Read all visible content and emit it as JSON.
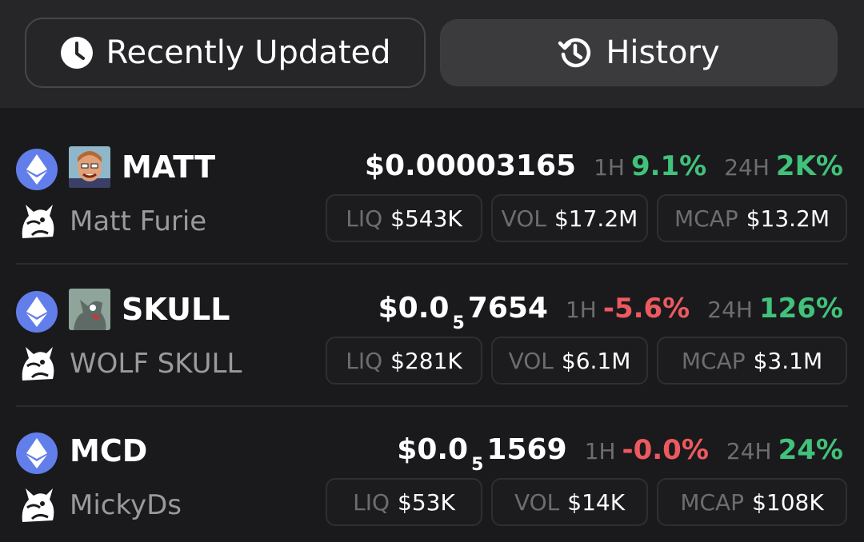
{
  "tabs": {
    "recent_label": "Recently Updated",
    "history_label": "History"
  },
  "stat_labels": {
    "h1": "1H",
    "h24": "24H",
    "liq": "LIQ",
    "vol": "VOL",
    "mcap": "MCAP"
  },
  "colors": {
    "positive": "#41c27a",
    "negative": "#ec5a5f",
    "eth": "#627eea"
  },
  "tokens": [
    {
      "symbol": "MATT",
      "name": "Matt Furie",
      "price_main": "$0.00003165",
      "price_sub": "",
      "price_tail": "",
      "change_1h": "9.1%",
      "change_24h": "2K%",
      "liq": "$543K",
      "vol": "$17.2M",
      "mcap": "$13.2M"
    },
    {
      "symbol": "SKULL",
      "name": "WOLF SKULL",
      "price_main": "$0.0",
      "price_sub": "5",
      "price_tail": "7654",
      "change_1h": "-5.6%",
      "change_24h": "126%",
      "liq": "$281K",
      "vol": "$6.1M",
      "mcap": "$3.1M"
    },
    {
      "symbol": "MCD",
      "name": "MickyDs",
      "price_main": "$0.0",
      "price_sub": "5",
      "price_tail": "1569",
      "change_1h": "-0.0%",
      "change_24h": "24%",
      "liq": "$53K",
      "vol": "$14K",
      "mcap": "$108K"
    }
  ]
}
